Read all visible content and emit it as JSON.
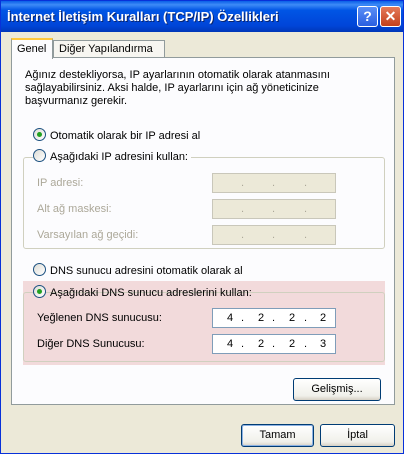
{
  "window": {
    "title": "İnternet İletişim Kuralları (TCP/IP) Özellikleri",
    "help_button": "?",
    "close_button": "✕"
  },
  "tabs": [
    {
      "label": "Genel",
      "active": true
    },
    {
      "label": "Diğer Yapılandırma",
      "active": false
    }
  ],
  "description": "Ağınız destekliyorsa, IP ayarlarının otomatik olarak atanmasını sağlayabilirsiniz. Aksi halde, IP ayarlarını için ağ yöneticinize başvurmanız gerekir.",
  "ip_section": {
    "auto_option": {
      "label": "Otomatik olarak bir IP adresi al",
      "selected": true
    },
    "manual_option": {
      "label": "Aşağıdaki IP adresini kullan:",
      "selected": false
    },
    "fields": [
      {
        "label": "IP adresi:",
        "value": ". . .",
        "enabled": false
      },
      {
        "label": "Alt ağ maskesi:",
        "value": ". . .",
        "enabled": false
      },
      {
        "label": "Varsayılan ağ geçidi:",
        "value": ". . .",
        "enabled": false
      }
    ]
  },
  "dns_section": {
    "auto_option": {
      "label": "DNS sunucu adresini otomatik olarak al",
      "selected": false
    },
    "manual_option": {
      "label": "Aşağıdaki DNS sunucu adreslerini kullan:",
      "selected": true
    },
    "preferred": {
      "label": "Yeğlenen DNS sunucusu:",
      "octets": [
        "4",
        "2",
        "2",
        "2"
      ]
    },
    "alternate": {
      "label": "Diğer DNS Sunucusu:",
      "octets": [
        "4",
        "2",
        "2",
        "3"
      ]
    }
  },
  "buttons": {
    "advanced": "Gelişmiş...",
    "ok": "Tamam",
    "cancel": "İptal"
  },
  "colors": {
    "titlebar": "#0055e5",
    "highlight": "#dc8c8c",
    "selected_radio": "#21a121"
  }
}
